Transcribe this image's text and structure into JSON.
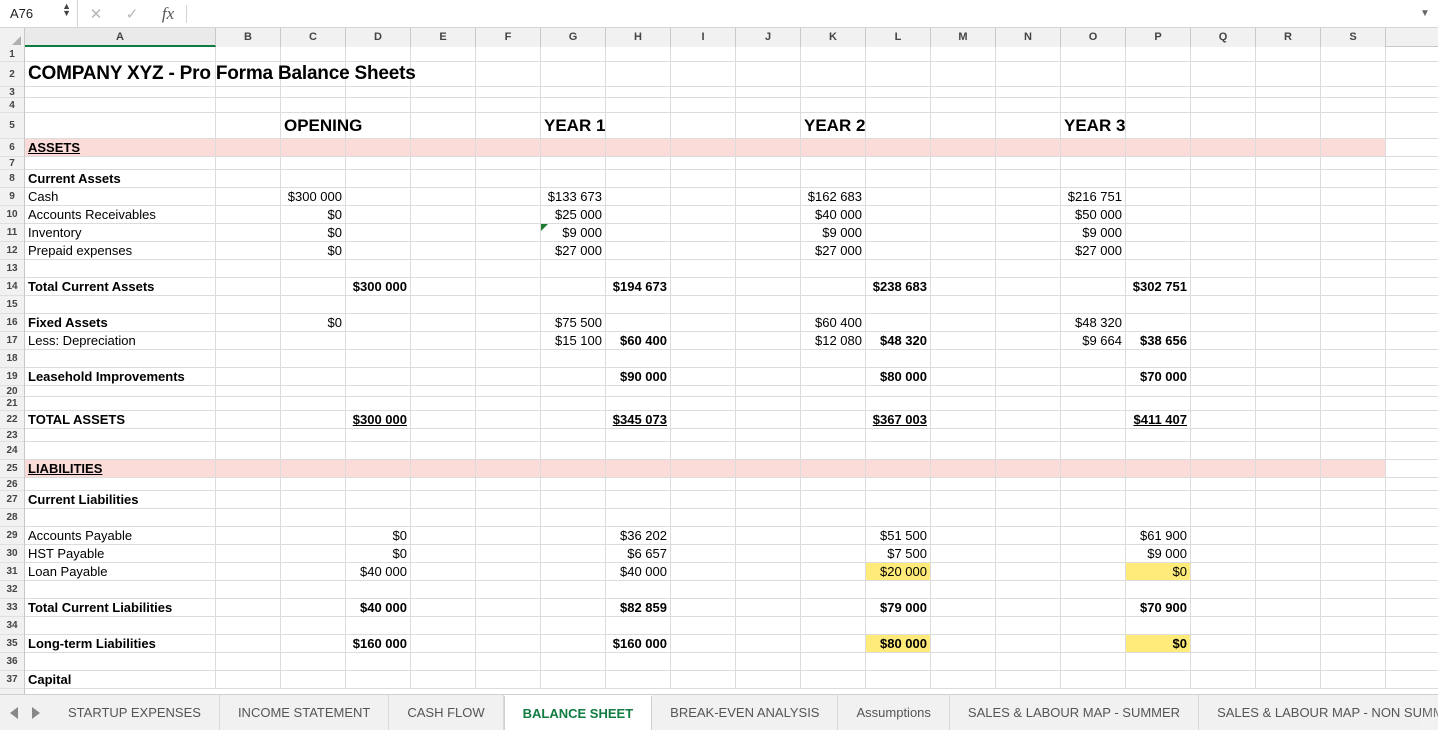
{
  "formula_bar": {
    "name_box_value": "A76",
    "formula_value": "",
    "cancel_icon": "close-icon",
    "confirm_icon": "check-icon",
    "function_icon": "fx-icon",
    "collapse_icon": "chevron-down-icon"
  },
  "grid": {
    "columns": [
      "A",
      "B",
      "C",
      "D",
      "E",
      "F",
      "G",
      "H",
      "I",
      "J",
      "K",
      "L",
      "M",
      "N",
      "O",
      "P",
      "Q",
      "R",
      "S"
    ],
    "selected_column": "A",
    "rows": [
      "1",
      "2",
      "3",
      "4",
      "5",
      "6",
      "7",
      "8",
      "9",
      "10",
      "11",
      "12",
      "13",
      "14",
      "15",
      "16",
      "17",
      "18",
      "19",
      "20",
      "21",
      "22",
      "23",
      "24",
      "25",
      "26",
      "27",
      "28",
      "29",
      "30",
      "31",
      "32",
      "33",
      "34",
      "35",
      "36",
      "37"
    ]
  },
  "sheet": {
    "title": "COMPANY XYZ - Pro Forma Balance Sheets",
    "period_headers": {
      "opening": "OPENING",
      "year1": "YEAR 1",
      "year2": "YEAR 2",
      "year3": "YEAR 3"
    },
    "section_assets": "ASSETS",
    "section_liabilities": "LIABILITIES",
    "labels": {
      "current_assets": "Current Assets",
      "cash": "Cash",
      "accounts_receivables": "Accounts Receivables",
      "inventory": "Inventory",
      "prepaid_expenses": "Prepaid expenses",
      "total_current_assets": "Total Current Assets",
      "fixed_assets": "Fixed Assets",
      "less_depreciation": "Less: Depreciation",
      "leasehold_improvements": "Leasehold Improvements",
      "total_assets": "TOTAL ASSETS",
      "current_liabilities": "Current Liabilities",
      "accounts_payable": "Accounts Payable",
      "hst_payable": "HST Payable",
      "loan_payable": "Loan Payable",
      "total_current_liabilities": "Total Current Liabilities",
      "longterm_liabilities": "Long-term Liabilities",
      "capital": "Capital"
    },
    "values": {
      "cash": {
        "opening": "$300 000",
        "year1": "$133 673",
        "year2": "$162 683",
        "year3": "$216 751"
      },
      "accounts_receivables": {
        "opening": "$0",
        "year1": "$25 000",
        "year2": "$40 000",
        "year3": "$50 000"
      },
      "inventory": {
        "opening": "$0",
        "year1": "$9 000",
        "year2": "$9 000",
        "year3": "$9 000"
      },
      "prepaid_expenses": {
        "opening": "$0",
        "year1": "$27 000",
        "year2": "$27 000",
        "year3": "$27 000"
      },
      "total_current_assets": {
        "opening": "$300 000",
        "year1": "$194 673",
        "year2": "$238 683",
        "year3": "$302 751"
      },
      "fixed_assets": {
        "opening": "$0",
        "year1": "$75 500",
        "year2": "$60 400",
        "year3": "$48 320"
      },
      "depreciation": {
        "year1": "$15 100",
        "year2": "$12 080",
        "year3": "$9 664"
      },
      "net_fixed_assets": {
        "year1": "$60 400",
        "year2": "$48 320",
        "year3": "$38 656"
      },
      "leasehold_improvements": {
        "year1": "$90 000",
        "year2": "$80 000",
        "year3": "$70 000"
      },
      "total_assets": {
        "opening": "$300 000",
        "year1": "$345 073",
        "year2": "$367 003",
        "year3": "$411 407"
      },
      "accounts_payable": {
        "opening": "$0",
        "year1": "$36 202",
        "year2": "$51 500",
        "year3": "$61 900"
      },
      "hst_payable": {
        "opening": "$0",
        "year1": "$6 657",
        "year2": "$7 500",
        "year3": "$9 000"
      },
      "loan_payable": {
        "opening": "$40 000",
        "year1": "$40 000",
        "year2": "$20 000",
        "year3": "$0"
      },
      "total_current_liabilities": {
        "opening": "$40 000",
        "year1": "$82 859",
        "year2": "$79 000",
        "year3": "$70 900"
      },
      "longterm_liabilities": {
        "opening": "$160 000",
        "year1": "$160 000",
        "year2": "$80 000",
        "year3": "$0"
      }
    },
    "highlight_color": "#ffeb7a",
    "section_band_color": "#fcdcd8",
    "comment_marker_color": "#1f7a32"
  },
  "tabs": {
    "items": [
      {
        "label": "STARTUP EXPENSES",
        "active": false
      },
      {
        "label": "INCOME STATEMENT",
        "active": false
      },
      {
        "label": "CASH FLOW",
        "active": false
      },
      {
        "label": "BALANCE SHEET",
        "active": true
      },
      {
        "label": "BREAK-EVEN ANALYSIS",
        "active": false
      },
      {
        "label": "Assumptions",
        "active": false
      },
      {
        "label": "SALES & LABOUR MAP - SUMMER",
        "active": false
      },
      {
        "label": "SALES & LABOUR MAP - NON SUMMER",
        "active": false
      }
    ],
    "add_label": "+",
    "prev_icon": "triangle-left-icon",
    "next_icon": "triangle-right-icon",
    "active_color": "#107c41"
  }
}
